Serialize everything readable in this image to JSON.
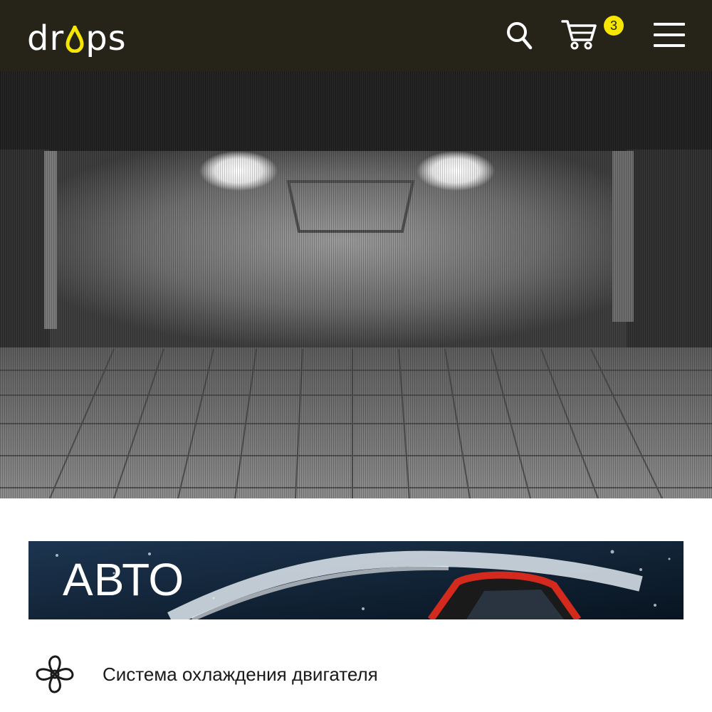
{
  "header": {
    "logo_left": "dr",
    "logo_right": "ps",
    "search_icon": "search-icon",
    "cart_icon": "cart-icon",
    "cart_count": "3",
    "menu_icon": "hamburger-menu-icon",
    "accent_color": "#f6e600",
    "background_color": "#262418"
  },
  "hero": {
    "image_subject": "car-in-wash-tunnel-photo"
  },
  "categories": [
    {
      "title": "АВТО",
      "image_subject": "red-car-splash-photo"
    }
  ],
  "services": [
    {
      "label": "Система охлаждения двигателя",
      "icon": "fan-icon"
    }
  ]
}
